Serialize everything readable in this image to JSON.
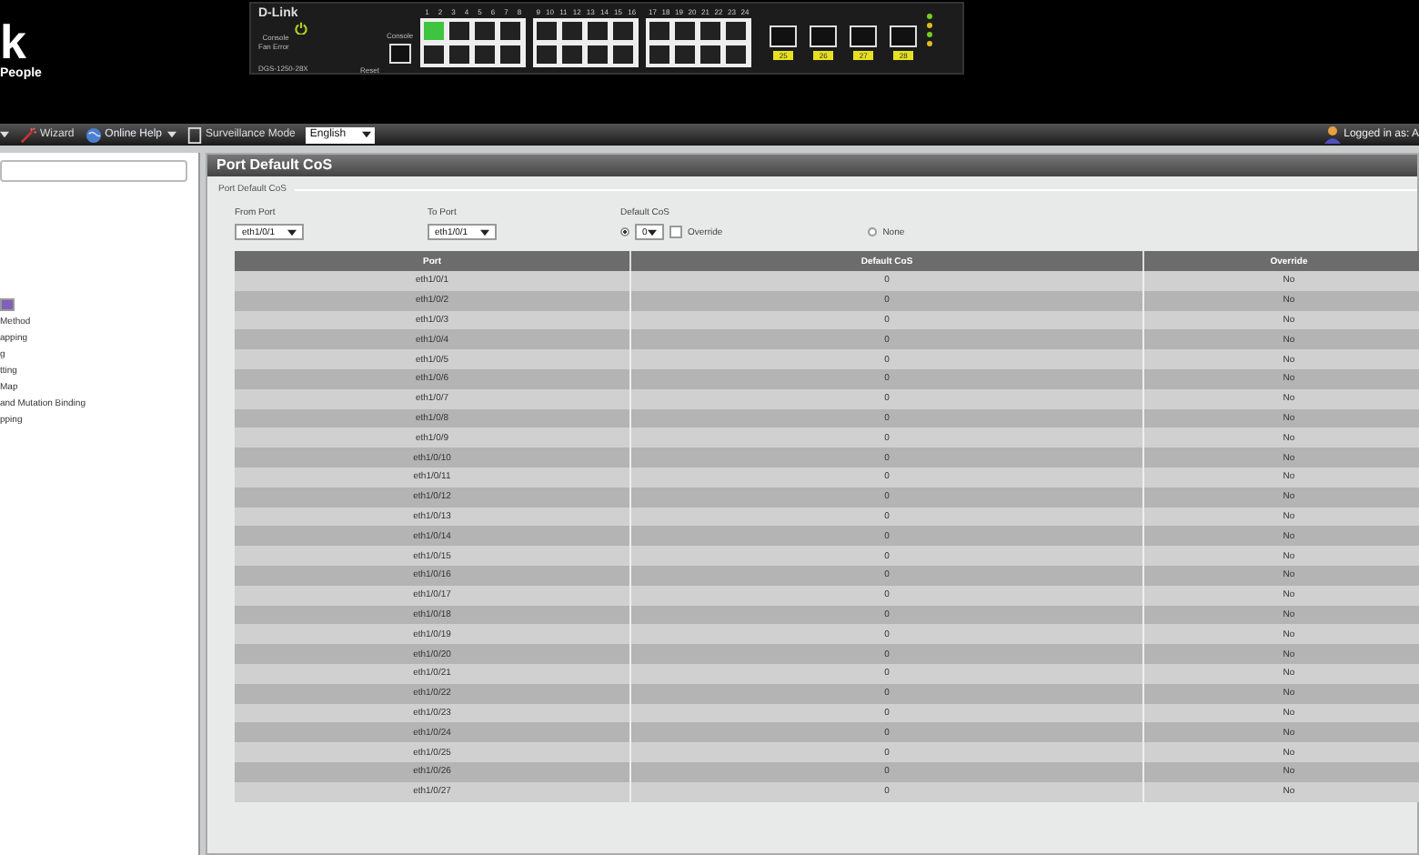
{
  "logo": {
    "mark": "k",
    "tagline": "People"
  },
  "device": {
    "brand": "D-Link",
    "leds": [
      "Console",
      "Fan Error"
    ],
    "reset_label": "Reset",
    "console_label": "Console",
    "model": "DGS-1250-28X",
    "port_groups": [
      {
        "numbers": [
          "1",
          "2",
          "3",
          "4",
          "5",
          "6",
          "7",
          "8"
        ],
        "ports": [
          {
            "link": true
          },
          {
            "link": false
          },
          {
            "link": false
          },
          {
            "link": false
          },
          {
            "link": false
          },
          {
            "link": false
          },
          {
            "link": false
          },
          {
            "link": false
          }
        ]
      },
      {
        "numbers": [
          "9",
          "10",
          "11",
          "12",
          "13",
          "14",
          "15",
          "16"
        ],
        "ports": [
          {
            "link": false
          },
          {
            "link": false
          },
          {
            "link": false
          },
          {
            "link": false
          },
          {
            "link": false
          },
          {
            "link": false
          },
          {
            "link": false
          },
          {
            "link": false
          }
        ]
      },
      {
        "numbers": [
          "17",
          "18",
          "19",
          "20",
          "21",
          "22",
          "23",
          "24"
        ],
        "ports": [
          {
            "link": false
          },
          {
            "link": false
          },
          {
            "link": false
          },
          {
            "link": false
          },
          {
            "link": false
          },
          {
            "link": false
          },
          {
            "link": false
          },
          {
            "link": false
          }
        ]
      }
    ],
    "sfp_ports": [
      "25",
      "26",
      "27",
      "28"
    ]
  },
  "toolbar": {
    "items": [
      {
        "label": "Wizard",
        "kind": "wizard",
        "dropdown": false
      },
      {
        "label": "Online Help",
        "kind": "help",
        "dropdown": true
      },
      {
        "label": "Surveillance Mode",
        "kind": "surveillance",
        "dropdown": false
      }
    ],
    "language": "English",
    "login": "Logged in as: A"
  },
  "sidebar": {
    "items": [
      {
        "selected": true
      },
      {
        "label": "Method",
        "selected": false
      },
      {
        "label": "apping",
        "selected": false
      },
      {
        "label": "g",
        "selected": false
      },
      {
        "label": "tting",
        "selected": false
      },
      {
        "label": "Map",
        "selected": false
      },
      {
        "label": "and Mutation Binding",
        "selected": false
      },
      {
        "label": "pping",
        "selected": false
      }
    ]
  },
  "panel": {
    "title": "Port Default CoS",
    "section": "Port Default CoS",
    "from_port": {
      "label": "From Port",
      "value": "eth1/0/1"
    },
    "to_port": {
      "label": "To Port",
      "value": "eth1/0/1"
    },
    "default_cos": {
      "label": "Default CoS",
      "options": [
        {
          "kind": "value",
          "selected": true,
          "value": "0"
        },
        {
          "kind": "none",
          "selected": false,
          "label": "None"
        }
      ],
      "override": {
        "label": "Override",
        "checked": false
      }
    },
    "table": {
      "columns": [
        "Port",
        "Default CoS",
        "Override"
      ],
      "rows": [
        [
          "eth1/0/1",
          "0",
          "No"
        ],
        [
          "eth1/0/2",
          "0",
          "No"
        ],
        [
          "eth1/0/3",
          "0",
          "No"
        ],
        [
          "eth1/0/4",
          "0",
          "No"
        ],
        [
          "eth1/0/5",
          "0",
          "No"
        ],
        [
          "eth1/0/6",
          "0",
          "No"
        ],
        [
          "eth1/0/7",
          "0",
          "No"
        ],
        [
          "eth1/0/8",
          "0",
          "No"
        ],
        [
          "eth1/0/9",
          "0",
          "No"
        ],
        [
          "eth1/0/10",
          "0",
          "No"
        ],
        [
          "eth1/0/11",
          "0",
          "No"
        ],
        [
          "eth1/0/12",
          "0",
          "No"
        ],
        [
          "eth1/0/13",
          "0",
          "No"
        ],
        [
          "eth1/0/14",
          "0",
          "No"
        ],
        [
          "eth1/0/15",
          "0",
          "No"
        ],
        [
          "eth1/0/16",
          "0",
          "No"
        ],
        [
          "eth1/0/17",
          "0",
          "No"
        ],
        [
          "eth1/0/18",
          "0",
          "No"
        ],
        [
          "eth1/0/19",
          "0",
          "No"
        ],
        [
          "eth1/0/20",
          "0",
          "No"
        ],
        [
          "eth1/0/21",
          "0",
          "No"
        ],
        [
          "eth1/0/22",
          "0",
          "No"
        ],
        [
          "eth1/0/23",
          "0",
          "No"
        ],
        [
          "eth1/0/24",
          "0",
          "No"
        ],
        [
          "eth1/0/25",
          "0",
          "No"
        ],
        [
          "eth1/0/26",
          "0",
          "No"
        ],
        [
          "eth1/0/27",
          "0",
          "No"
        ]
      ]
    }
  }
}
